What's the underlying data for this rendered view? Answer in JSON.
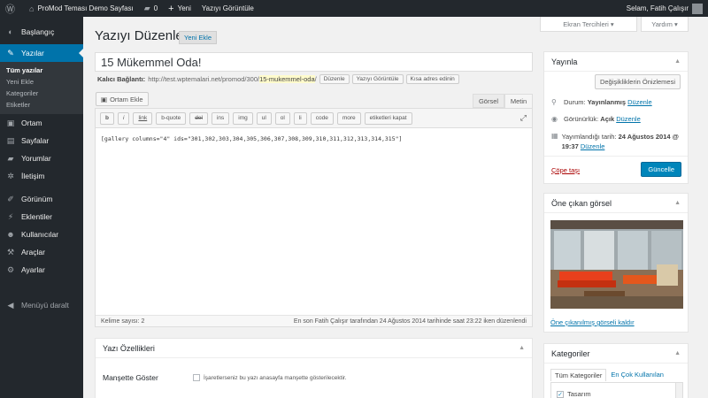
{
  "adminbar": {
    "site_name": "ProMod Teması Demo Sayfası",
    "comments_count": "0",
    "new_label": "Yeni",
    "view_post": "Yazıyı Görüntüle",
    "greeting": "Selam, Fatih Çalışır",
    "icons": [
      "wordpress-icon",
      "home-icon",
      "comment-icon",
      "plus-icon"
    ]
  },
  "sidebar": {
    "items": [
      {
        "label": "Başlangıç",
        "icon": "dashboard-icon"
      },
      {
        "label": "Yazılar",
        "icon": "pin-icon",
        "active": true
      },
      {
        "label": "Ortam",
        "icon": "media-icon"
      },
      {
        "label": "Sayfalar",
        "icon": "page-icon"
      },
      {
        "label": "Yorumlar",
        "icon": "comment-icon"
      },
      {
        "label": "İletişim",
        "icon": "gear-icon"
      },
      {
        "label": "Görünüm",
        "icon": "brush-icon"
      },
      {
        "label": "Eklentiler",
        "icon": "plugin-icon"
      },
      {
        "label": "Kullanıcılar",
        "icon": "user-icon"
      },
      {
        "label": "Araçlar",
        "icon": "wrench-icon"
      },
      {
        "label": "Ayarlar",
        "icon": "settings-icon"
      }
    ],
    "submenu": [
      "Tüm yazılar",
      "Yeni Ekle",
      "Kategoriler",
      "Etiketler"
    ],
    "collapse": "Menüyü daralt"
  },
  "header": {
    "title": "Yazıyı Düzenle",
    "add_new": "Yeni Ekle",
    "screen_options": "Ekran Tercihleri ▾",
    "help": "Yardım ▾"
  },
  "post": {
    "title": "15 Mükemmel Oda!",
    "permalink_label": "Kalıcı Bağlantı:",
    "permalink_base": "http://test.wptemalari.net/promod/300/",
    "permalink_slug": "15-mukemmel-oda",
    "permalink_end": "/",
    "edit_btn": "Düzenle",
    "view_btn": "Yazıyı Görüntüle",
    "short_btn": "Kısa adres edinin"
  },
  "editor": {
    "media_btn": "Ortam Ekle",
    "tab_visual": "Görsel",
    "tab_text": "Metin",
    "quicktags": [
      "b",
      "i",
      "link",
      "b-quote",
      "del",
      "ins",
      "img",
      "ul",
      "ol",
      "li",
      "code",
      "more",
      "etiketleri kapat"
    ],
    "content": "[gallery columns=\"4\" ids=\"301,302,303,304,305,306,307,308,309,310,311,312,313,314,315\"]",
    "word_count": "Kelime sayısı: 2",
    "last_edited": "En son Fatih Çalışır tarafından 24 Ağustos 2014 tarihinde saat 23:22 iken düzenlendi"
  },
  "post_props": {
    "title": "Yazı Özellikleri",
    "headline_label": "Manşette Göster",
    "headline_desc": "İşaretlerseniz bu yazı anasayfa manşette gösterilecektir."
  },
  "publish": {
    "title": "Yayınla",
    "preview_btn": "Değişikliklerin Önizlemesi",
    "status_label": "Durum:",
    "status_value": "Yayınlanmış",
    "status_edit": "Düzenle",
    "visibility_label": "Görünürlük:",
    "visibility_value": "Açık",
    "visibility_edit": "Düzenle",
    "date_label": "Yayımlandığı tarih:",
    "date_value": "24 Ağustos 2014 @ 19:37",
    "date_edit": "Düzenle",
    "trash": "Çöpe taşı",
    "update_btn": "Güncelle"
  },
  "featured": {
    "title": "Öne çıkan görsel",
    "remove": "Öne çıkanılmış görseli kaldır"
  },
  "categories": {
    "title": "Kategoriler",
    "tab_all": "Tüm Kategoriler",
    "tab_popular": "En Çok Kullanılan",
    "first": "Tasarım"
  },
  "colors": {
    "admin_dark": "#23282d",
    "accent": "#0073aa",
    "primary_btn": "#0085ba",
    "trash": "#a00"
  }
}
